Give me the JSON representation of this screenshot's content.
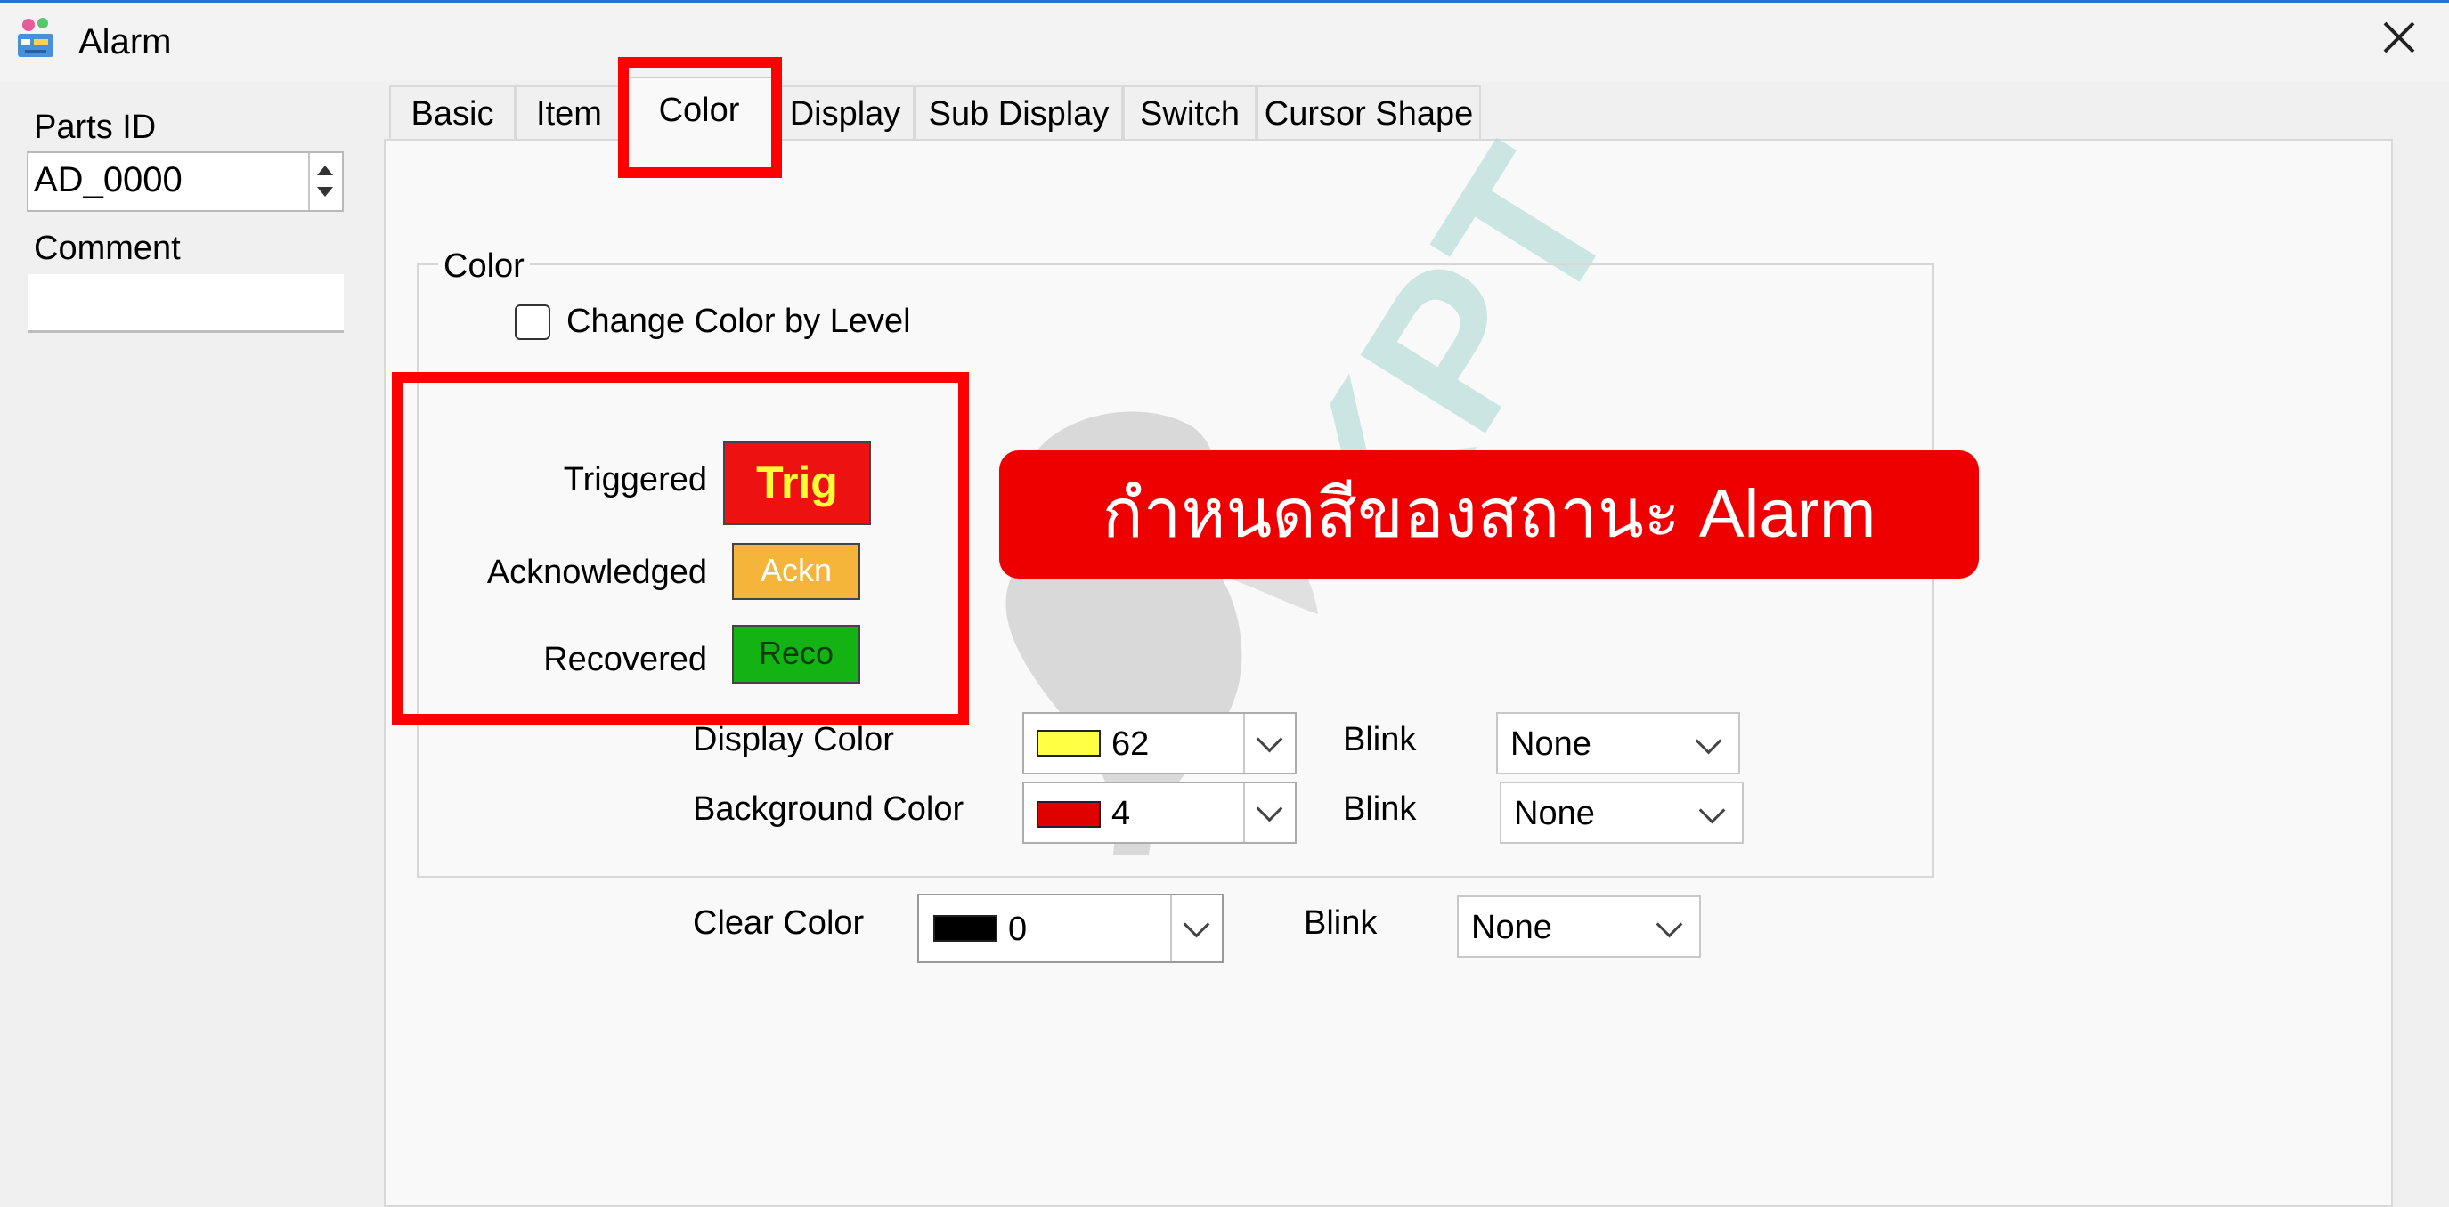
{
  "window": {
    "title": "Alarm"
  },
  "left_panel": {
    "parts_id_label": "Parts ID",
    "parts_id_value": "AD_0000",
    "comment_label": "Comment",
    "comment_value": ""
  },
  "tabs": [
    {
      "label": "Basic"
    },
    {
      "label": "Item"
    },
    {
      "label": "Color"
    },
    {
      "label": "Display"
    },
    {
      "label": "Sub Display"
    },
    {
      "label": "Switch"
    },
    {
      "label": "Cursor Shape"
    }
  ],
  "active_tab": "Color",
  "color_group": {
    "title": "Color",
    "change_by_level_label": "Change Color by Level",
    "change_by_level_checked": false,
    "states": [
      {
        "label": "Triggered",
        "swatch_text": "Trig",
        "bg": "#ee1111",
        "fg": "#ffff33"
      },
      {
        "label": "Acknowledged",
        "swatch_text": "Ackn",
        "bg": "#f5b43a",
        "fg": "#ffffff"
      },
      {
        "label": "Recovered",
        "swatch_text": "Reco",
        "bg": "#12b312",
        "fg": "#0a3d0a"
      }
    ],
    "display_color_label": "Display Color",
    "display_color_value": "62",
    "display_color_hex": "#ffff44",
    "display_blink_label": "Blink",
    "display_blink_value": "None",
    "background_color_label": "Background Color",
    "background_color_value": "4",
    "background_color_hex": "#e00000",
    "background_blink_label": "Blink",
    "background_blink_value": "None"
  },
  "clear_color": {
    "label": "Clear Color",
    "value": "0",
    "hex": "#000000",
    "blink_label": "Blink",
    "blink_value": "None"
  },
  "annotation": {
    "callout_text": "กำหนดสีของสถานะ Alarm",
    "highlight_color": "#ff0000"
  },
  "watermark": {
    "text": "KPT"
  }
}
